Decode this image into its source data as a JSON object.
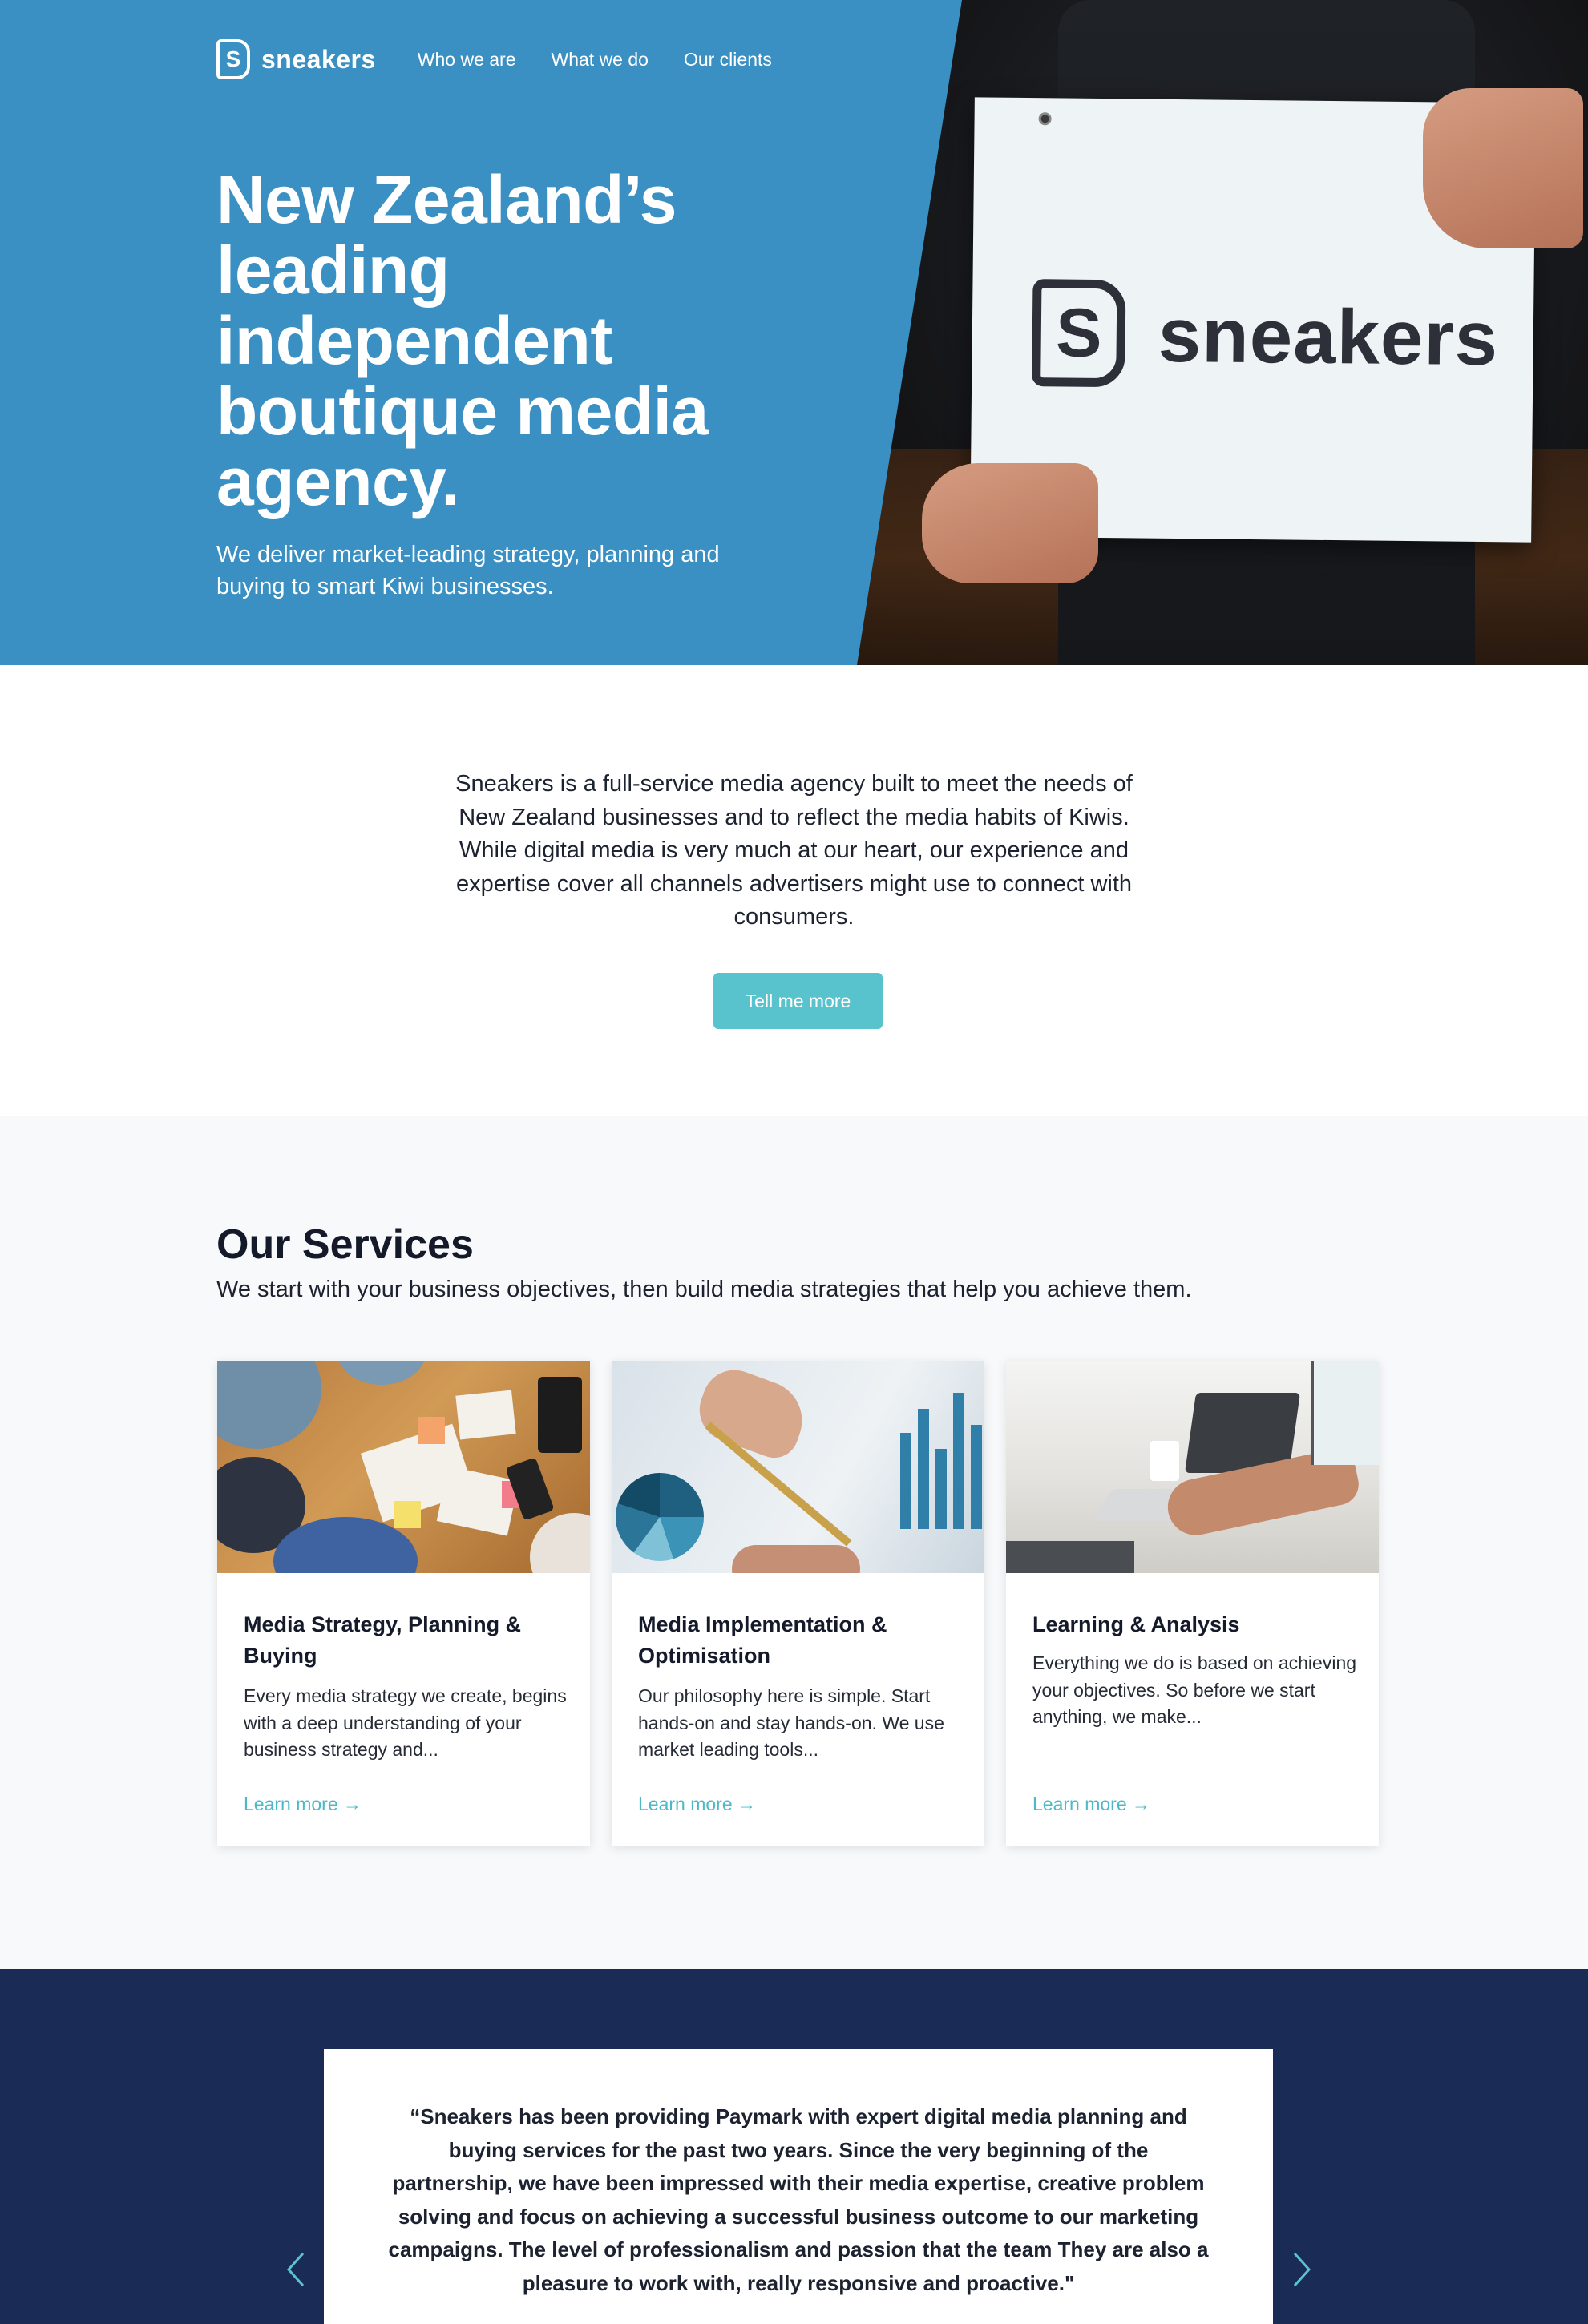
{
  "nav": {
    "logo_letter": "S",
    "brand": "sneakers",
    "links": [
      "Who we are",
      "What we do",
      "Our clients"
    ]
  },
  "hero": {
    "title": "New Zealand’s leading independent boutique media agency.",
    "subtitle": "We deliver market-leading strategy, planning and buying to smart Kiwi businesses.",
    "sign_letter": "S",
    "sign_word": "sneakers"
  },
  "intro": {
    "text": "Sneakers is a full-service media agency built to meet the needs of New Zealand businesses and to reflect the media habits of Kiwis. While digital media is very much at our heart, our experience and expertise cover all channels advertisers might use to connect with consumers.",
    "button": "Tell me more"
  },
  "services": {
    "title": "Our Services",
    "subtitle": "We start with your business objectives, then build media strategies that help you achieve them.",
    "cards": [
      {
        "title": "Media Strategy, Planning & Buying",
        "description": "Every media strategy we create, begins with a deep understanding of your business strategy and...",
        "link": "Learn more →"
      },
      {
        "title": "Media Implementation & Optimisation",
        "description": "Our philosophy here is simple. Start hands-on and stay hands-on. We use market leading tools...",
        "link": "Learn more →"
      },
      {
        "title": "Learning & Analysis",
        "description": "Everything we do is based on achieving your objectives. So before we start anything, we make...",
        "link": "Learn more →"
      }
    ]
  },
  "testimonial": {
    "quote": "“Sneakers has been providing Paymark with expert digital media planning and buying services for the past two years. Since the very beginning of the partnership, we have been impressed with their media expertise, creative problem solving and focus on achieving a successful business outcome to our marketing campaigns. The level of professionalism and passion that the team They are also a pleasure to work with, really responsive and proactive.\""
  },
  "colors": {
    "hero_blue": "#3b90c3",
    "accent_teal": "#58c3cc",
    "navy": "#1a2c55",
    "services_bg": "#f8f9fb"
  }
}
